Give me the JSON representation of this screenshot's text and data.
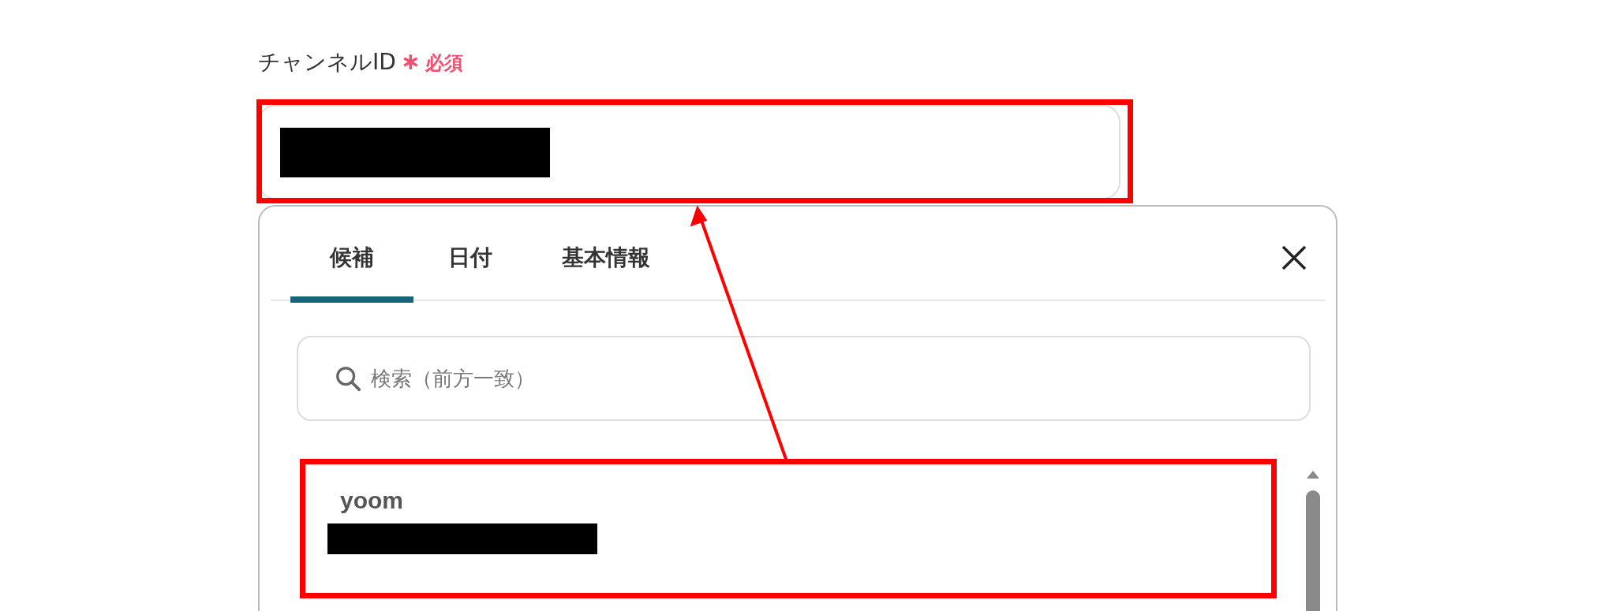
{
  "field": {
    "label": "チャンネルID",
    "required_mark": "∗",
    "required_text": "必須"
  },
  "picker": {
    "tabs": [
      {
        "label": "候補",
        "selected": true
      },
      {
        "label": "日付",
        "selected": false
      },
      {
        "label": "基本情報",
        "selected": false
      }
    ],
    "search": {
      "placeholder": "検索（前方一致）"
    },
    "items": [
      {
        "title": "yoom"
      }
    ]
  }
}
